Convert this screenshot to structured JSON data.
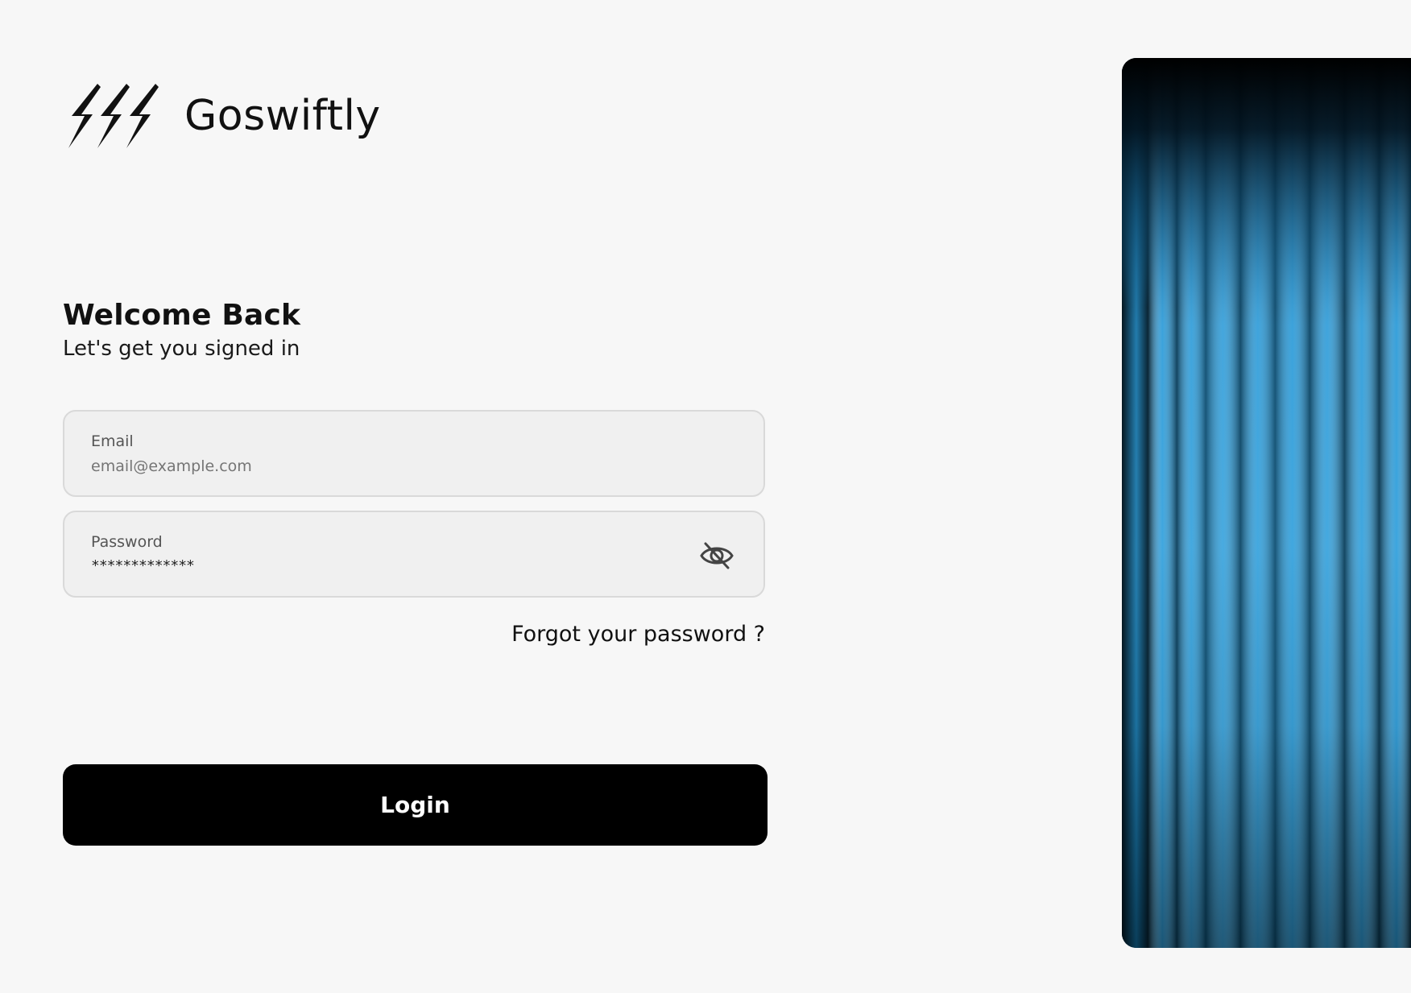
{
  "brand": {
    "name": "Goswiftly",
    "logo_icon": "lightning-bolts-icon"
  },
  "heading": {
    "title": "Welcome Back",
    "subtitle": "Let's get you signed in"
  },
  "form": {
    "email": {
      "label": "Email",
      "placeholder": "email@example.com",
      "value": ""
    },
    "password": {
      "label": "Password",
      "value": "*************",
      "toggle_icon": "eye-off-icon"
    },
    "forgot_label": "Forgot your password ?",
    "login_label": "Login"
  },
  "colors": {
    "background": "#f7f7f7",
    "field_background": "#f0f0f0",
    "field_border": "#d9d9d9",
    "button": "#000000",
    "button_text": "#ffffff",
    "hero_accent": "#2a9ad8"
  },
  "hero": {
    "description_icon": "blue-curtain-image"
  }
}
